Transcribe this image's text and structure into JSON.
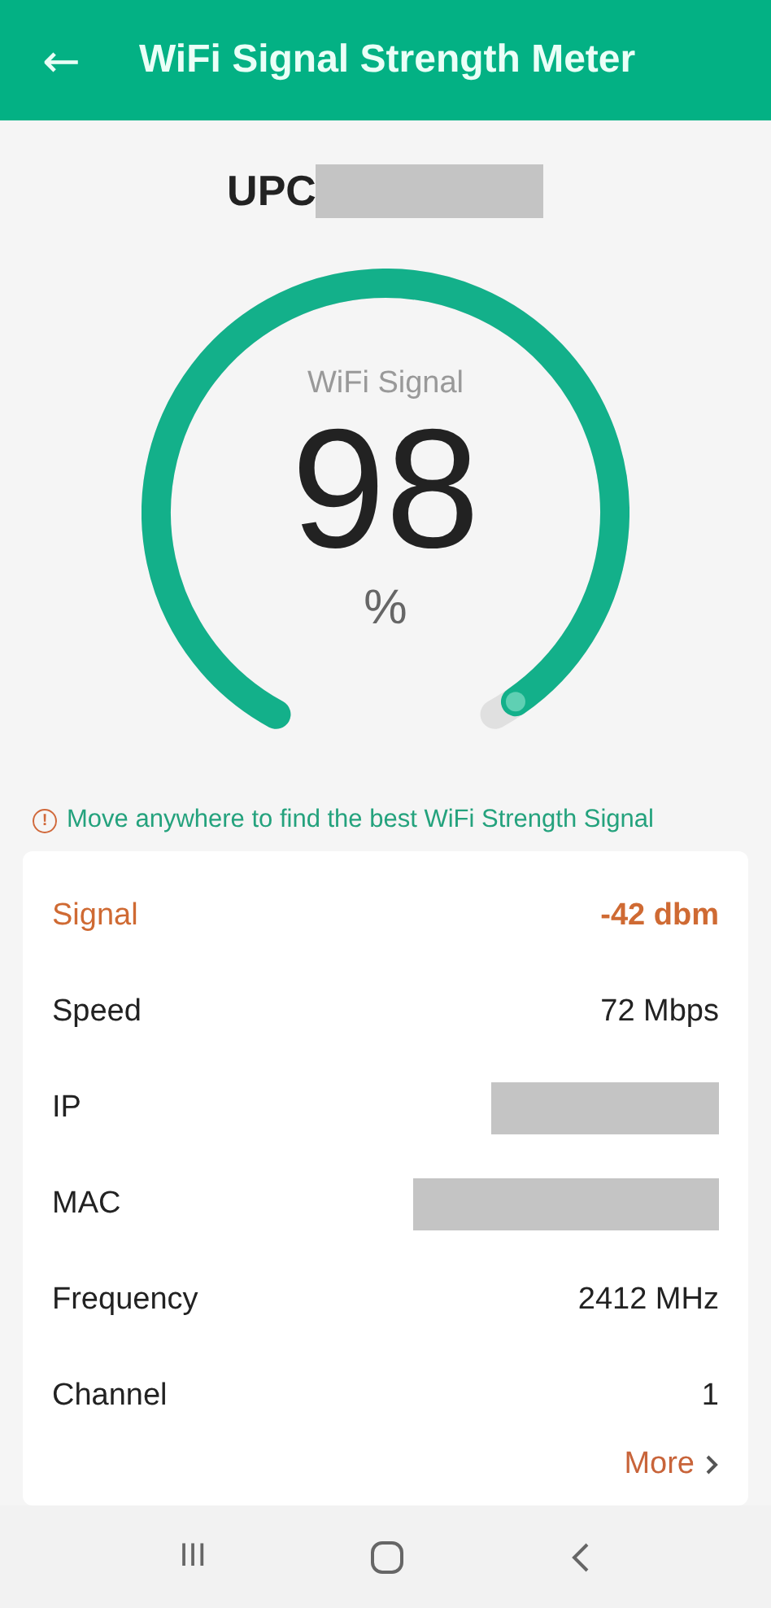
{
  "header": {
    "back": "←",
    "title": "WiFi Signal Strength Meter"
  },
  "network": {
    "name": "UPC",
    "redacted": true
  },
  "gauge": {
    "label": "WiFi Signal",
    "value": "98",
    "unit": "%"
  },
  "hint": {
    "icon": "!",
    "text": "Move anywhere to find the best WiFi Strength Signal"
  },
  "details": [
    {
      "label": "Signal",
      "value": "-42 dbm",
      "kind": "highlight"
    },
    {
      "label": "Speed",
      "value": "72 Mbps",
      "kind": "plain"
    },
    {
      "label": "IP",
      "kind": "hidden"
    },
    {
      "label": "MAC",
      "kind": "hidden"
    },
    {
      "label": "Frequency",
      "value": "2412 MHz",
      "kind": "plain"
    },
    {
      "label": "Channel",
      "value": "1",
      "kind": "plain"
    }
  ],
  "more": "More",
  "nav": [
    "III"
  ]
}
